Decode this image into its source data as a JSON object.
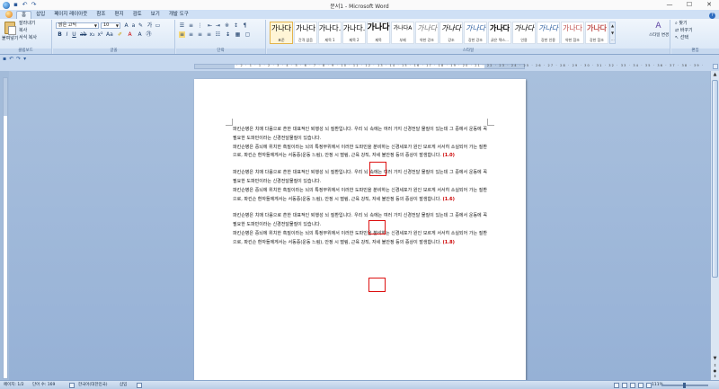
{
  "window": {
    "title": "문서1 - Microsoft Word",
    "minimize": "—",
    "maximize": "☐",
    "close": "✕"
  },
  "tabs": [
    "홈",
    "삽입",
    "페이지 레이아웃",
    "참조",
    "편지",
    "검토",
    "보기",
    "개발 도구"
  ],
  "ribbon": {
    "clipboard": {
      "label": "클립보드",
      "paste": "붙여넣기",
      "cut": "잘라내기",
      "copy": "복사",
      "format_painter": "서식 복사"
    },
    "font": {
      "label": "글꼴",
      "font_name": "맑은 고딕",
      "font_size": "10"
    },
    "paragraph": {
      "label": "단락"
    },
    "styles": {
      "label": "스타일",
      "items": [
        {
          "sample": "가나다",
          "name": "표준"
        },
        {
          "sample": "가나다",
          "name": "간격 없음"
        },
        {
          "sample": "가나다.",
          "name": "제목 1"
        },
        {
          "sample": "가나다.",
          "name": "제목 2"
        },
        {
          "sample": "가나다",
          "name": "제목"
        },
        {
          "sample": "가나다A",
          "name": "부제"
        },
        {
          "sample": "가나다",
          "name": "약한 강조"
        },
        {
          "sample": "가나다",
          "name": "강조"
        },
        {
          "sample": "가나다",
          "name": "강한 강조"
        },
        {
          "sample": "가나다",
          "name": "굵은 텍스..."
        },
        {
          "sample": "가나다",
          "name": "인용"
        },
        {
          "sample": "가나다",
          "name": "강한 인용"
        },
        {
          "sample": "가나다",
          "name": "약한 참조"
        },
        {
          "sample": "가나다",
          "name": "강한 참조"
        }
      ],
      "change_styles": "스타일 변경"
    },
    "editing": {
      "label": "편집",
      "find": "찾기",
      "replace": "바꾸기",
      "select": "선택"
    }
  },
  "ruler_numbers": "· 2 · 1 · 1 · 2 · 3 · 4 · 5 · 6 · 7 · 8 · 9 · 10 · 11 · 12 · 13 · 14 · 15 · 16 · 17 · 18 · 19 · 20 · 21 · 22 · 23 · 24 · 25 · 26 · 27 · 28 · 29 · 30 · 31 · 32 · 33 · 34 · 35 · 36 · 37 · 38 · 39 ·",
  "document": {
    "paragraphs": [
      {
        "line1": "파킨슨병은 치매 다음으로 흔한 대표적인 퇴행성 뇌 질환입니다. 우리 뇌 속에는 여러 가지 신경전달 물질이 있는데 그 중에서 운동에 꼭 필요한 도파민이라는 신경전달물질이 있습니다.",
        "line2": "파킨슨병은 중뇌에 위치한 흑질이라는 뇌의 특정부위에서 이러한 도파민을 분비하는 신경세포가 원인 모르게 서서히 소실되어 가는 질환으로, 파킨슨 환자들에게서는 서동증(운동 느림), 안정 시 떨림, 근육 강직, 자세 불안정 등의 증상이 발생합니다.",
        "spacing": "(1.0)"
      },
      {
        "line1": "파킨슨병은 치매 다음으로 흔한 대표적인 퇴행성 뇌 질환입니다. 우리 뇌 속에는 여러 가지 신경전달 물질이 있는데 그 중에서 운동에 꼭 필요한 도파민이라는 신경전달물질이 있습니다.",
        "line2": "파킨슨병은 중뇌에 위치한 흑질이라는 뇌의 특정부위에서 이러한 도파민을 분비하는 신경세포가 원인 모르게 서서히 소실되어 가는 질환으로, 파킨슨 환자들에게서는 서동증(운동 느림), 안정 시 떨림, 근육 강직, 자세 불안정 등의 증상이 발생합니다.",
        "spacing": "(1.6)"
      },
      {
        "line1": "파킨슨병은 치매 다음으로 흔한 대표적인 퇴행성 뇌 질환입니다. 우리 뇌 속에는 여러 가지 신경전달 물질이 있는데 그 중에서 운동에 꼭 필요한 도파민이라는 신경전달물질이 있습니다.",
        "line2": "파킨슨병은 중뇌에 위치한 흑질이라는 뇌의 특정부위에서 이러한 도파민을 분비하는 신경세포가 원인 모르게 서서히 소실되어 가는 질환으로, 파킨슨 환자들에게서는 서동증(운동 느림), 안정 시 떨림, 근육 강직, 자세 불안정 등의 증상이 발생합니다.",
        "spacing": "(1.8)"
      }
    ]
  },
  "status": {
    "page": "페이지: 1/2",
    "words": "단어 수: 169",
    "language": "한국어(대한민국)",
    "mode": "삽입",
    "zoom": "111%"
  },
  "colors": {
    "accent_red": "#cc0000",
    "ribbon_blue": "#cfe0f5",
    "doc_bg": "#a3bbd9"
  }
}
